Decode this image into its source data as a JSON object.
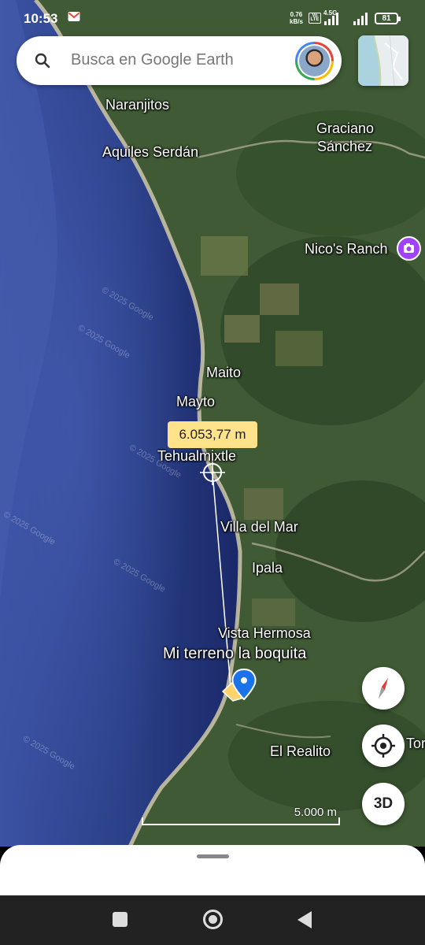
{
  "status_bar": {
    "time": "10:53",
    "netspeed_value": "0.76",
    "netspeed_unit": "kB/s",
    "volte": "Vo LTE",
    "network": "4.5G",
    "battery": "81"
  },
  "search": {
    "placeholder": "Busca en Google Earth",
    "icon": "search-icon"
  },
  "map": {
    "places": [
      "Naranjitos",
      "Aquiles Serdán",
      "Graciano",
      "Sánchez",
      "Nico's Ranch",
      "Maito",
      "Mayto",
      "Tehualmixtle",
      "Villa del Mar",
      "Ipala",
      "Vista Hermosa",
      "Mi terreno la boquita",
      "El Realito",
      "Tor"
    ],
    "watermark": "© 2025 Google",
    "measurement": "6.053,77 m",
    "scale": "5.000 m"
  },
  "controls": {
    "compass": "compass-icon",
    "my_location": "my-location-icon",
    "threed_label": "3D"
  },
  "colors": {
    "ocean": "#2a3f86",
    "land": "#3f5a35",
    "pin": "#1a73e8",
    "measure_tag": "#ffe38a"
  }
}
